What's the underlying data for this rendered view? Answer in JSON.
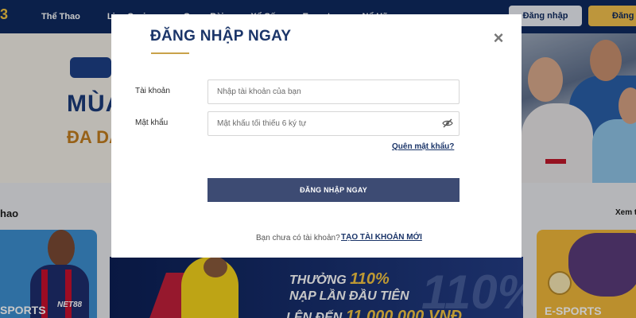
{
  "header": {
    "nav": [
      "Thể Thao",
      "Live Casino",
      "Game Bài",
      "Xổ Số",
      "Esports",
      "Nổ Hũ",
      "Lô Đề",
      "Khuyến Mãi"
    ],
    "login_button": "Đăng nhập",
    "register_button": "Đăng ký"
  },
  "hero": {
    "line1": "MÙA",
    "line2": "ĐA DẠ"
  },
  "section": {
    "title": "hao",
    "more": "Xem tất"
  },
  "cards": {
    "left_label": "SPORTS",
    "left_brand": "NET88",
    "right_label": "E-SPORTS"
  },
  "promo": {
    "line1_prefix": "THƯỞNG",
    "line1_value": "110%",
    "line2": "NẠP LẦN ĐẦU TIÊN",
    "line3_prefix": "LÊN ĐẾN",
    "line3_value": "11.000.000 VNĐ",
    "bg_number": "110%"
  },
  "modal": {
    "title": "ĐĂNG NHẬP NGAY",
    "close_icon": "×",
    "username_label": "Tài khoản",
    "username_placeholder": "Nhập tài khoản của bạn",
    "password_label": "Mật khẩu",
    "password_placeholder": "Mật khẩu tối thiểu 6 ký tự",
    "forgot_password": "Quên mật khẩu?",
    "submit_button": "ĐĂNG NHẬP NGAY",
    "no_account_text": "Bạn chưa có tài khoản?",
    "create_account": "TẠO TÀI KHOẢN MỚI"
  },
  "colors": {
    "navy": "#0f2a5f",
    "title_blue": "#1b3569",
    "accent_gold": "#c9a24a",
    "submit_bg": "#3d4b73"
  }
}
